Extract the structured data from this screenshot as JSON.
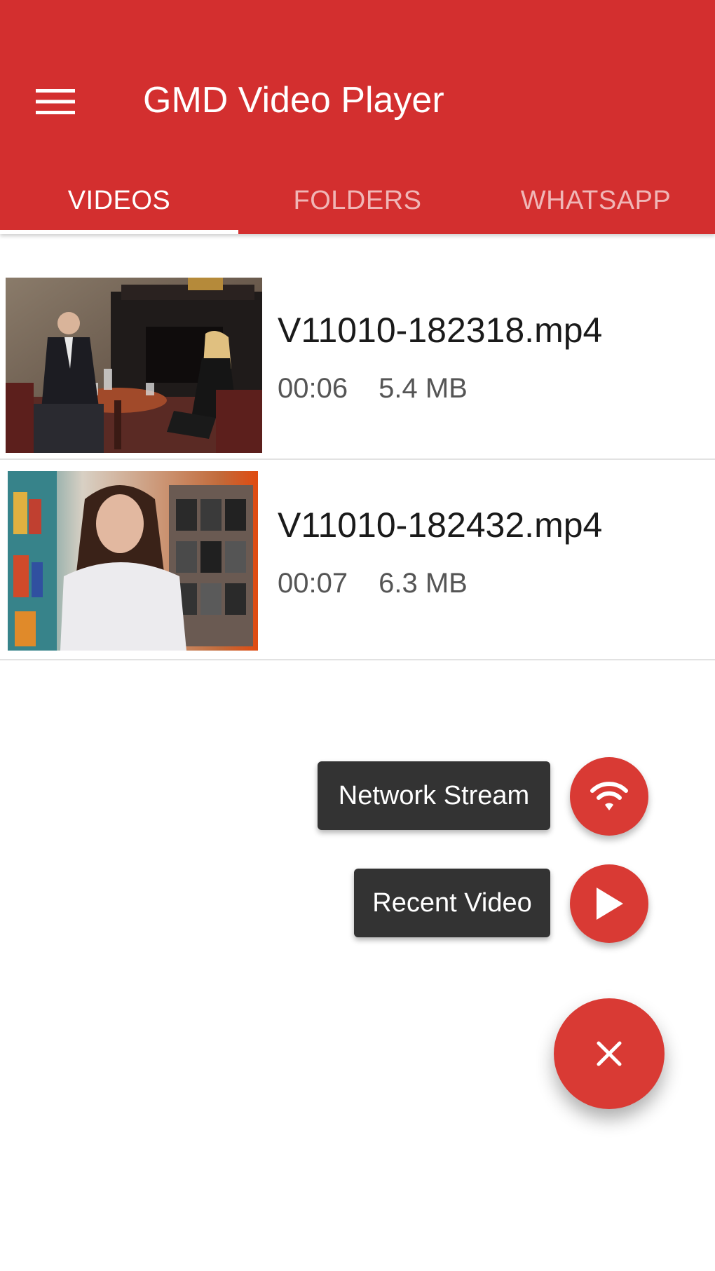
{
  "app": {
    "title": "GMD Video Player",
    "accent_color": "#d32f2f",
    "fab_color": "#d93a34"
  },
  "toolbar": {
    "menu_icon": "hamburger-menu-icon"
  },
  "tabs": [
    {
      "label": "VIDEOS",
      "active": true
    },
    {
      "label": "FOLDERS",
      "active": false
    },
    {
      "label": "WHATSAPP",
      "active": false
    }
  ],
  "videos": [
    {
      "filename": "V11010-182318.mp4",
      "duration": "00:06",
      "size": "5.4 MB",
      "thumbnail_icon": "video-thumbnail-couple-at-table"
    },
    {
      "filename": "V11010-182432.mp4",
      "duration": "00:07",
      "size": "6.3 MB",
      "thumbnail_icon": "video-thumbnail-woman-in-store"
    }
  ],
  "fab_menu": {
    "network_stream_label": "Network Stream",
    "network_stream_icon": "wifi-icon",
    "recent_video_label": "Recent Video",
    "recent_video_icon": "play-icon",
    "close_icon": "close-icon"
  }
}
